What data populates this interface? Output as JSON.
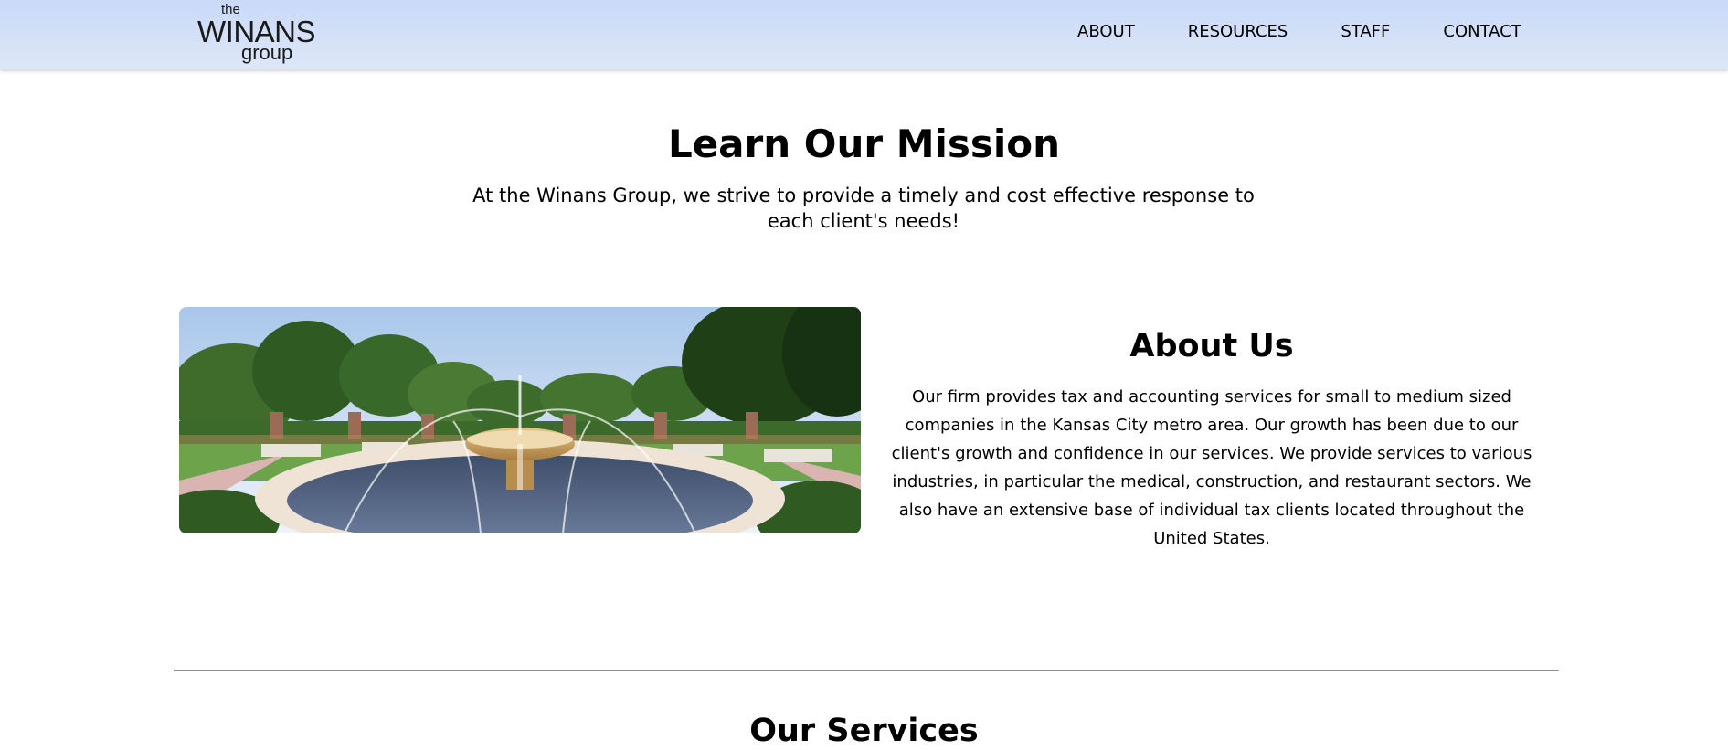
{
  "header": {
    "logo": {
      "line1": "the",
      "line2": "WINANS",
      "line3": "group"
    },
    "nav": [
      {
        "label": "ABOUT"
      },
      {
        "label": "RESOURCES"
      },
      {
        "label": "STAFF"
      },
      {
        "label": "CONTACT"
      }
    ]
  },
  "mission": {
    "title": "Learn Our Mission",
    "text": "At the Winans Group, we strive to provide a timely and cost effective response to each client's needs!"
  },
  "about": {
    "image_subject": "fountain-garden-photo",
    "title": "About Us",
    "text": "Our firm provides tax and accounting services for small to medium sized companies in the Kansas City metro area. Our growth has been due to our client's growth and confidence in our services. We provide services to various industries, in particular the medical, construction, and restaurant sectors. We also have an extensive base of individual tax clients located throughout the United States."
  },
  "services": {
    "title": "Our Services"
  },
  "colors": {
    "header_top": "#c9d9f8",
    "header_bottom": "#dde7f7",
    "divider": "#8c8c8c"
  }
}
